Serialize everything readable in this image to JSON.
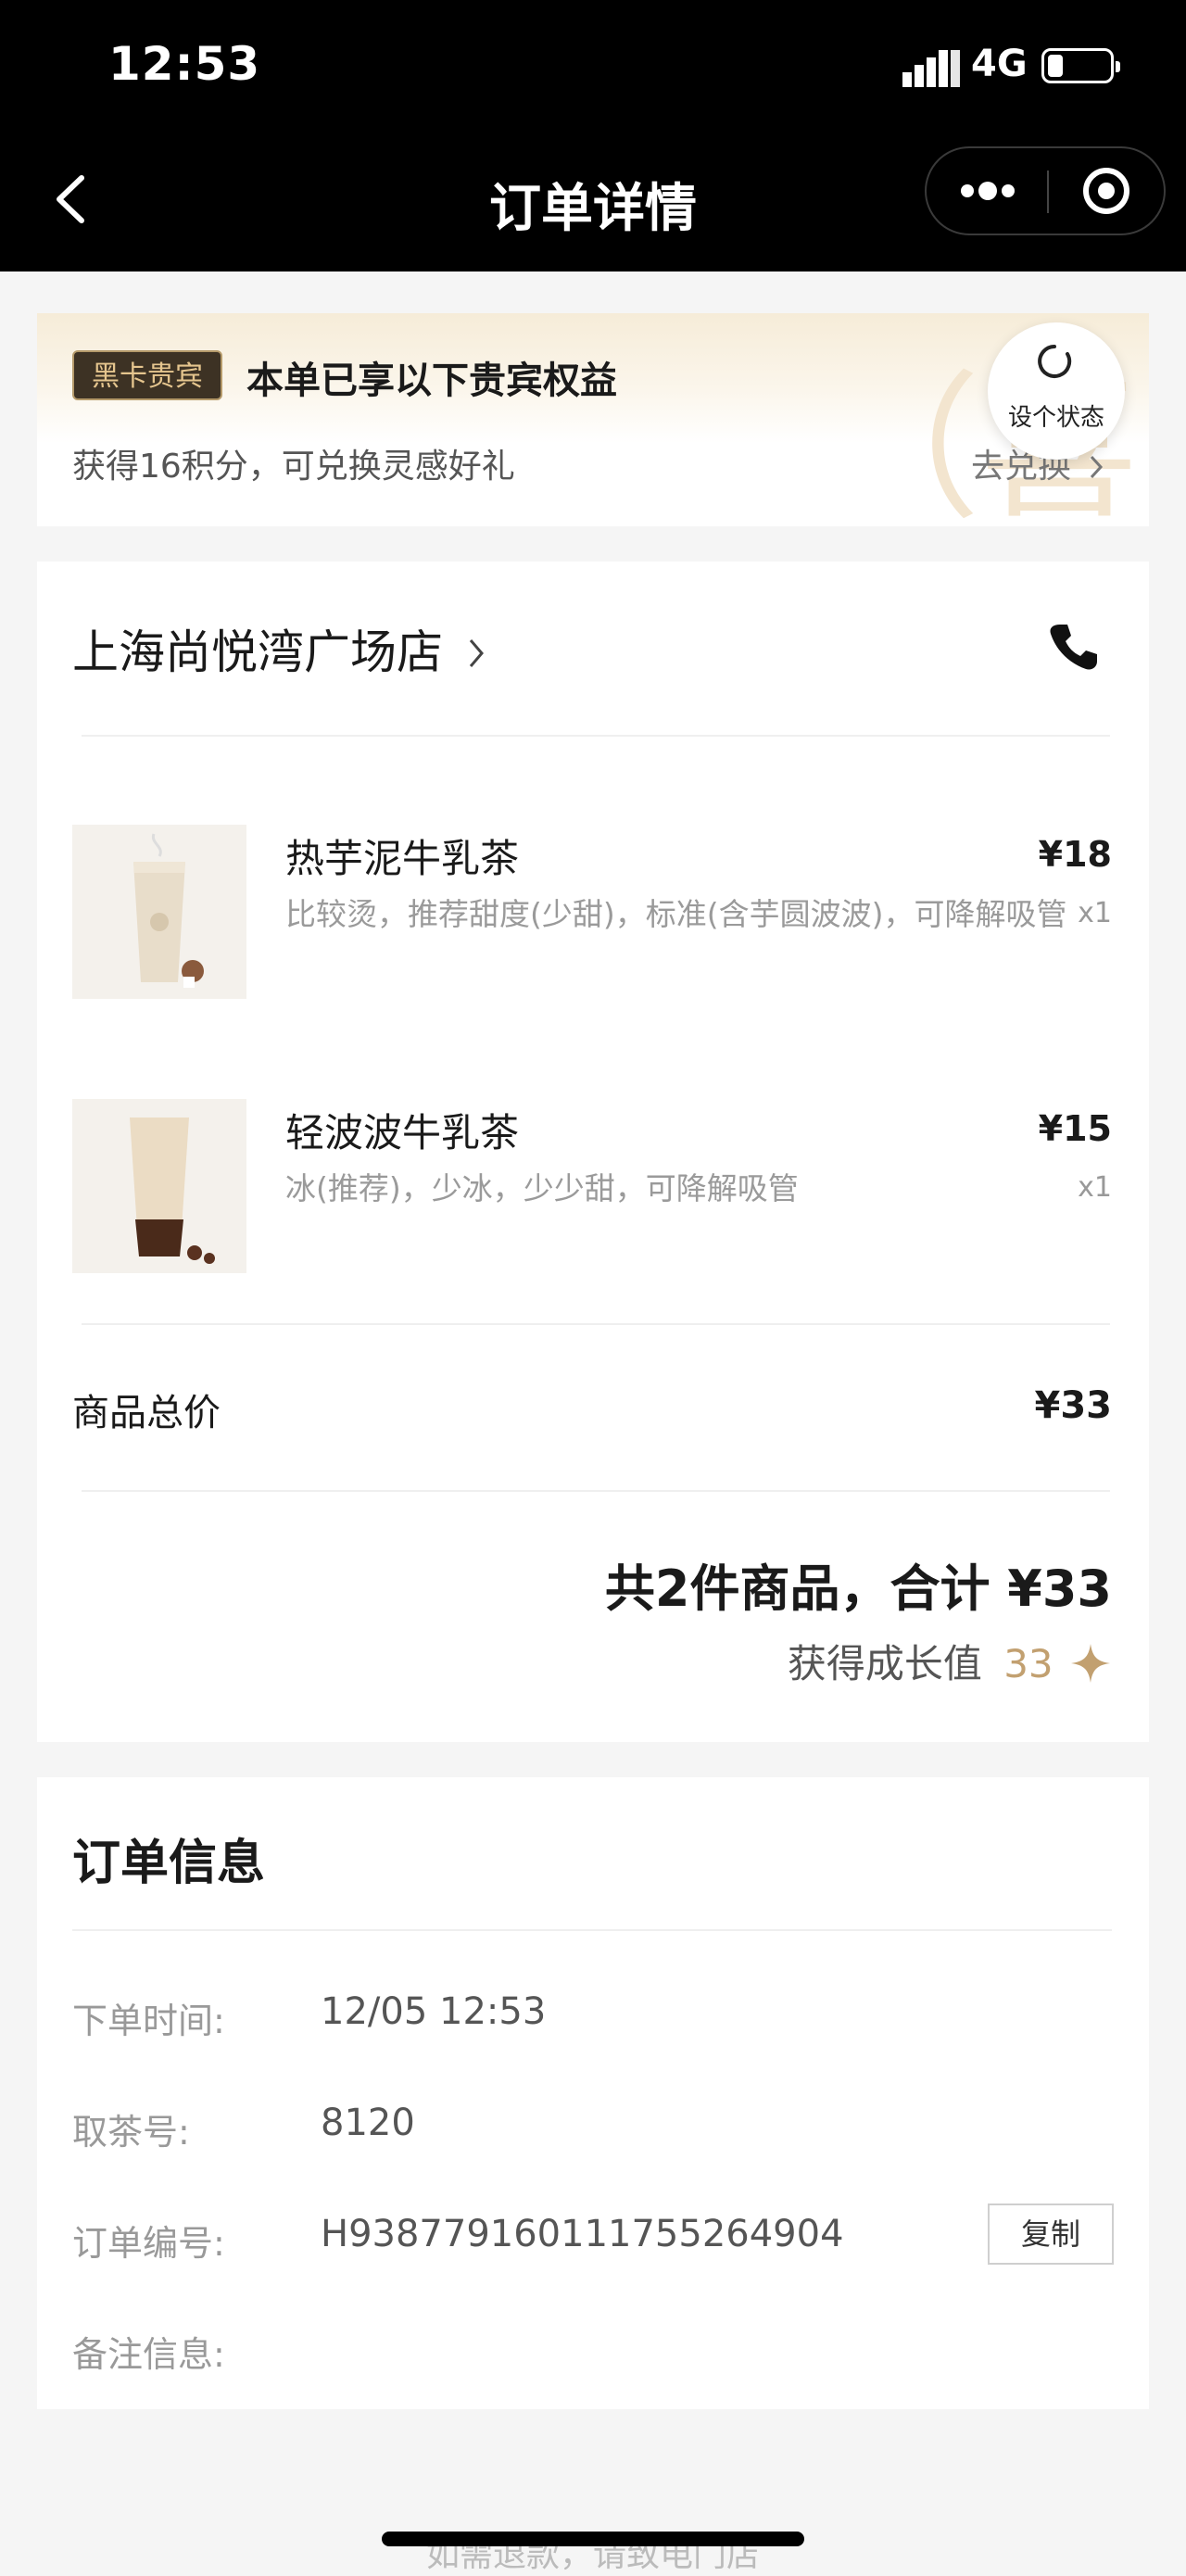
{
  "status_bar": {
    "time": "12:53",
    "network": "4G",
    "battery_level": 0.2
  },
  "nav": {
    "title": "订单详情"
  },
  "vip": {
    "badge": "黑卡贵宾",
    "title": "本单已享以下贵宾权益",
    "subtitle": "获得16积分，可兑换灵感好礼",
    "exchange": "去兑换",
    "watermark": "（喜",
    "state_button": "设个状态"
  },
  "order": {
    "store": "上海尚悦湾广场店",
    "items": [
      {
        "name": "热芋泥牛乳茶",
        "desc": "比较烫，推荐甜度(少甜)，标准(含芋圆波波)，可降解吸管",
        "price": "¥18",
        "qty": "x1"
      },
      {
        "name": "轻波波牛乳茶",
        "desc": "冰(推荐)，少冰，少少甜，可降解吸管",
        "price": "¥15",
        "qty": "x1"
      }
    ],
    "subtotal_label": "商品总价",
    "subtotal": "¥33",
    "total_line": "共2件商品，合计 ¥33",
    "growth_label": "获得成长值",
    "growth_value": "33"
  },
  "info": {
    "title": "订单信息",
    "rows": [
      {
        "label": "下单时间:",
        "value": "12/05 12:53"
      },
      {
        "label": "取茶号:",
        "value": "8120"
      },
      {
        "label": "订单编号:",
        "value": "H938779160111755264904"
      },
      {
        "label": "备注信息:",
        "value": ""
      }
    ],
    "copy": "复制"
  },
  "footer": "如需退款，请致电门店",
  "colors": {
    "accent_gold": "#c2a070",
    "badge_bg": "#3d3224"
  }
}
